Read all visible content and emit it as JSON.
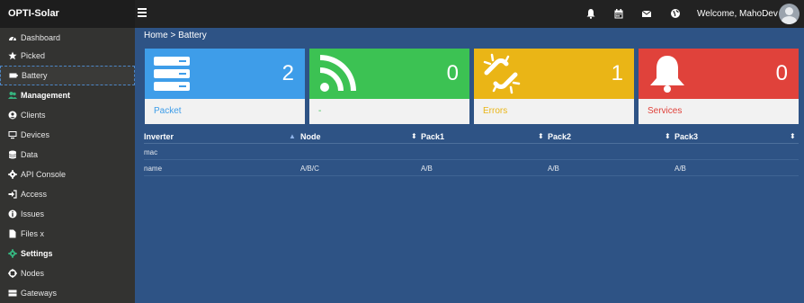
{
  "app": {
    "brand": "OPTI-Solar"
  },
  "topbar": {
    "icons": [
      "bell-icon",
      "calendar-icon",
      "envelope-icon",
      "globe-icon"
    ],
    "welcome": "Welcome, MahoDev"
  },
  "sidebar": {
    "items": [
      {
        "label": "Dashboard",
        "icon": "dashboard-icon"
      },
      {
        "label": "Picked",
        "icon": "star-icon"
      },
      {
        "label": "Battery",
        "icon": "battery-icon",
        "active": true
      },
      {
        "label": "Management",
        "icon": "users-icon",
        "section": true
      },
      {
        "label": "Clients",
        "icon": "user-circle-icon"
      },
      {
        "label": "Devices",
        "icon": "desktop-icon"
      },
      {
        "label": "Data",
        "icon": "database-icon"
      },
      {
        "label": "API Console",
        "icon": "gear-icon"
      },
      {
        "label": "Access",
        "icon": "sign-in-icon"
      },
      {
        "label": "Issues",
        "icon": "info-icon"
      },
      {
        "label": "Files x",
        "icon": "file-icon"
      },
      {
        "label": "Settings",
        "icon": "cog-icon",
        "section": true
      },
      {
        "label": "Nodes",
        "icon": "nodes-icon"
      },
      {
        "label": "Gateways",
        "icon": "server-icon"
      }
    ]
  },
  "breadcrumb": "Home > Battery",
  "cards": [
    {
      "count": "2",
      "label": "Packet",
      "icon": "server-stack-icon",
      "color": "#3e9de9",
      "label_color": "#3e9de9"
    },
    {
      "count": "0",
      "label": "-",
      "icon": "rss-icon",
      "color": "#3cc253",
      "label_color": "#3cc253"
    },
    {
      "count": "1",
      "label": "Errors",
      "icon": "broken-link-icon",
      "color": "#eab516",
      "label_color": "#eab516"
    },
    {
      "count": "0",
      "label": "Services",
      "icon": "bell-icon",
      "color": "#e0423b",
      "label_color": "#e0423b"
    }
  ],
  "table": {
    "columns": [
      "Inverter",
      "Node",
      "Pack1",
      "Pack2",
      "Pack3"
    ],
    "rows": [
      [
        "mac",
        "",
        "",
        "",
        ""
      ],
      [
        "name",
        "A/B/C",
        "A/B",
        "A/B",
        "A/B"
      ]
    ]
  }
}
